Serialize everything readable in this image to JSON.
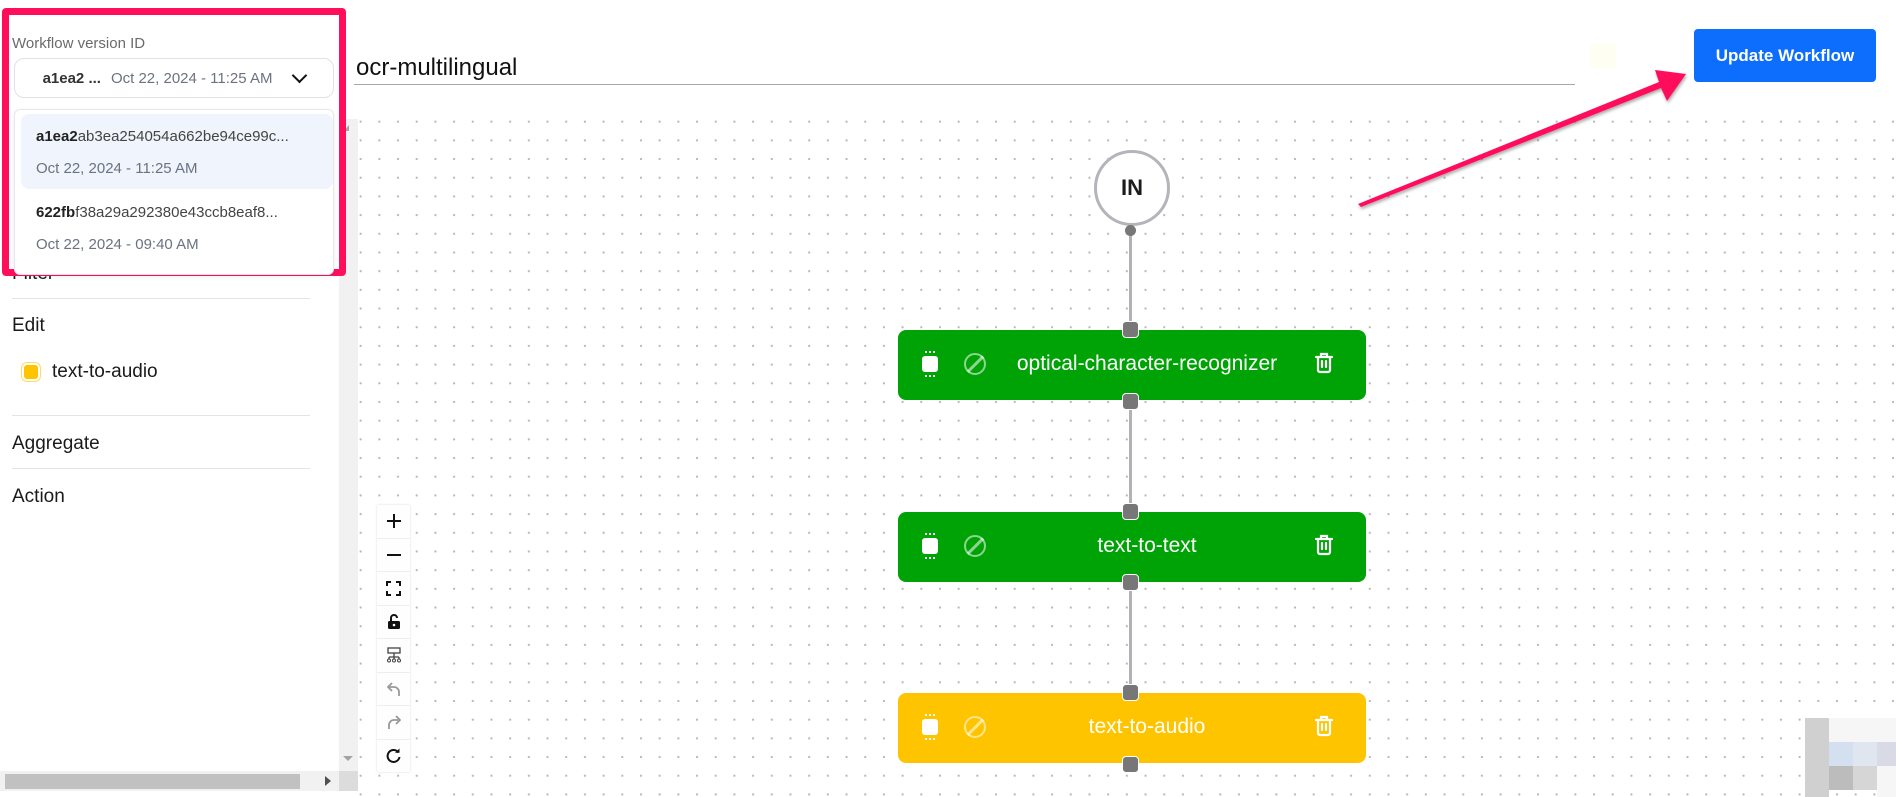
{
  "sidebar": {
    "sections": [
      {
        "label": "Filter"
      },
      {
        "label": "Edit"
      },
      {
        "label": "Aggregate"
      },
      {
        "label": "Action"
      }
    ],
    "edit_items": [
      {
        "label": "text-to-audio",
        "icon": "chip-icon",
        "color": "#ffc400"
      }
    ]
  },
  "version_selector": {
    "label": "Workflow version ID",
    "selected": {
      "id_short": "a1ea2 ...",
      "date": "Oct 22, 2024 - 11:25 AM"
    },
    "options": [
      {
        "id_prefix": "a1ea2",
        "id_rest": "ab3ea254054a662be94ce99c...",
        "date": "Oct 22, 2024 - 11:25 AM",
        "selected": true
      },
      {
        "id_prefix": "622fb",
        "id_rest": "f38a29a292380e43ccb8eaf8...",
        "date": "Oct 22, 2024 - 09:40 AM",
        "selected": false
      }
    ],
    "annotation_color": "#ff0f5b"
  },
  "header": {
    "workflow_name": "ocr-multilingual",
    "update_button_label": "Update Workflow",
    "update_button_color": "#0d6efd"
  },
  "canvas": {
    "input_node_label": "IN",
    "nodes": [
      {
        "label": "optical-character-recognizer",
        "status": "enabled",
        "color": "#00a305"
      },
      {
        "label": "text-to-text",
        "status": "enabled",
        "color": "#00a305"
      },
      {
        "label": "text-to-audio",
        "status": "selected",
        "color": "#ffc400"
      }
    ],
    "controls": [
      {
        "name": "zoom-in",
        "icon": "plus-icon"
      },
      {
        "name": "zoom-out",
        "icon": "minus-icon"
      },
      {
        "name": "fit-view",
        "icon": "fit-view-icon"
      },
      {
        "name": "lock",
        "icon": "lock-icon"
      },
      {
        "name": "auto-layout",
        "icon": "layout-tree-icon"
      },
      {
        "name": "undo",
        "icon": "undo-icon"
      },
      {
        "name": "redo",
        "icon": "redo-icon"
      },
      {
        "name": "refresh",
        "icon": "refresh-icon"
      }
    ]
  }
}
